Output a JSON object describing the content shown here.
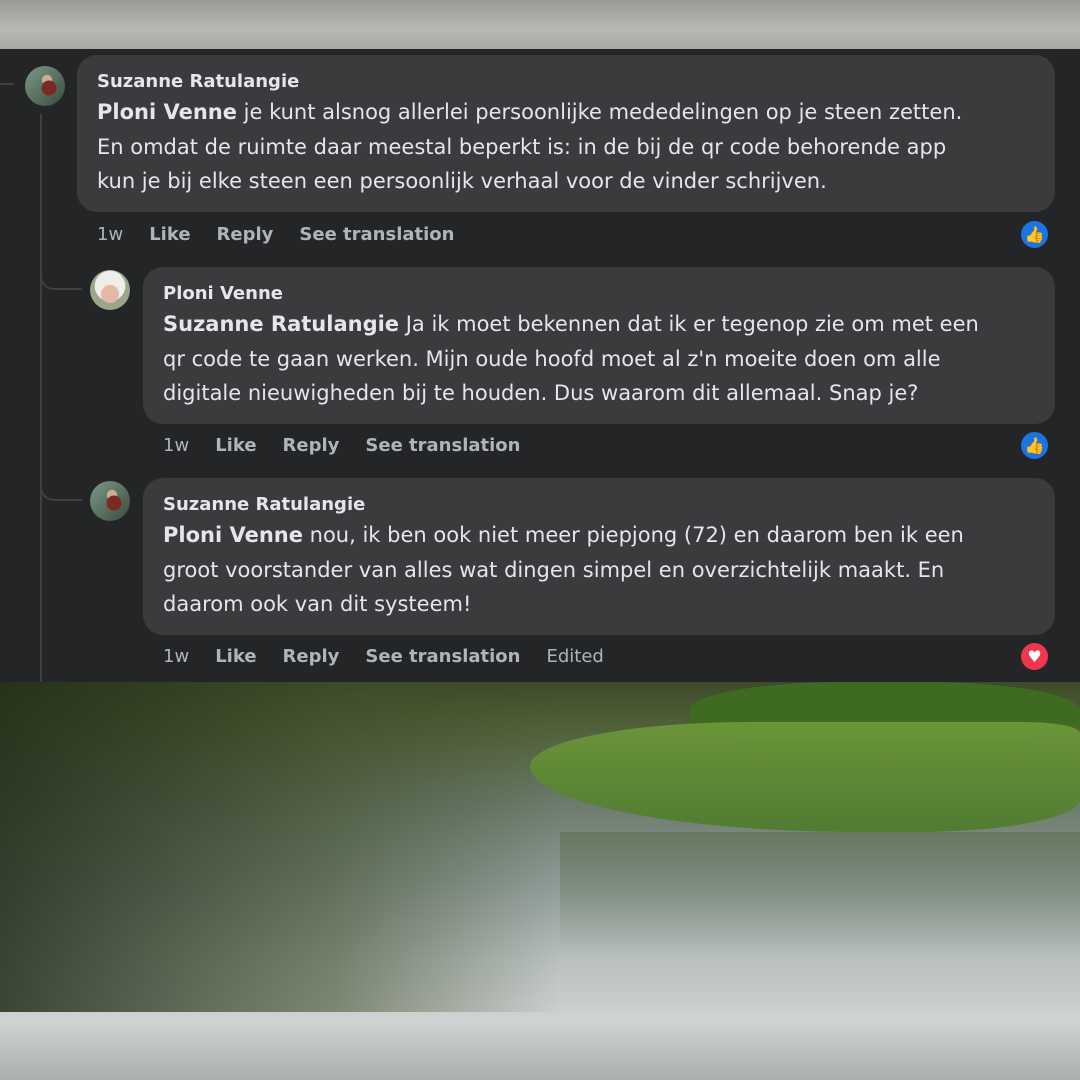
{
  "comments": [
    {
      "author": "Suzanne Ratulangie",
      "mention": "Ploni Venne",
      "lines": [
        " je kunt alsnog allerlei persoonlijke mededelingen op je steen zetten.",
        "En omdat de ruimte daar meestal beperkt is: in de bij de qr code behorende app",
        "kun je bij elke steen een persoonlijk verhaal voor de vinder schrijven."
      ],
      "time": "1w",
      "like": "Like",
      "reply": "Reply",
      "translate": "See translation",
      "reaction": "like-icon"
    },
    {
      "author": "Ploni Venne",
      "mention": "Suzanne Ratulangie",
      "lines": [
        " Ja ik moet bekennen dat ik er tegenop zie om met een",
        "qr code te gaan werken. Mijn oude hoofd moet al z'n moeite doen om alle",
        "digitale nieuwigheden bij te houden. Dus waarom dit allemaal. Snap je?"
      ],
      "time": "1w",
      "like": "Like",
      "reply": "Reply",
      "translate": "See translation",
      "reaction": "like-icon"
    },
    {
      "author": "Suzanne Ratulangie",
      "mention": "Ploni Venne",
      "lines": [
        " nou, ik ben ook niet meer piepjong (72) en daarom ben ik een",
        "groot voorstander van alles wat dingen simpel en overzichtelijk maakt. En",
        "daarom ook van dit systeem!"
      ],
      "time": "1w",
      "like": "Like",
      "reply": "Reply",
      "translate": "See translation",
      "edited": "Edited",
      "reaction": "heart-icon"
    }
  ],
  "colors": {
    "panel": "#242526",
    "bubble": "#3a3b3c",
    "like": "#1b74e4",
    "love": "#f0354e"
  }
}
